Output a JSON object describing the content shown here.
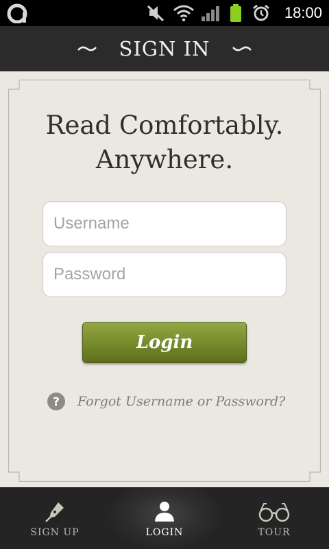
{
  "status_bar": {
    "time": "18:00",
    "icons": [
      "app-logo-icon",
      "mute-icon",
      "wifi-icon",
      "signal-icon",
      "battery-icon",
      "alarm-icon"
    ]
  },
  "header": {
    "title": "SIGN IN"
  },
  "main": {
    "headline_line1": "Read Comfortably.",
    "headline_line2": "Anywhere.",
    "username_placeholder": "Username",
    "password_placeholder": "Password",
    "login_label": "Login",
    "forgot_label": "Forgot Username or Password?"
  },
  "bottom_nav": {
    "items": [
      {
        "label": "SIGN UP",
        "icon": "pen-nib-icon",
        "active": false
      },
      {
        "label": "LOGIN",
        "icon": "person-icon",
        "active": true
      },
      {
        "label": "TOUR",
        "icon": "glasses-icon",
        "active": false
      }
    ]
  },
  "colors": {
    "header_bg": "#2b2b2b",
    "page_bg": "#eae8e1",
    "accent_green": "#76892b",
    "nav_bg": "#242424"
  }
}
